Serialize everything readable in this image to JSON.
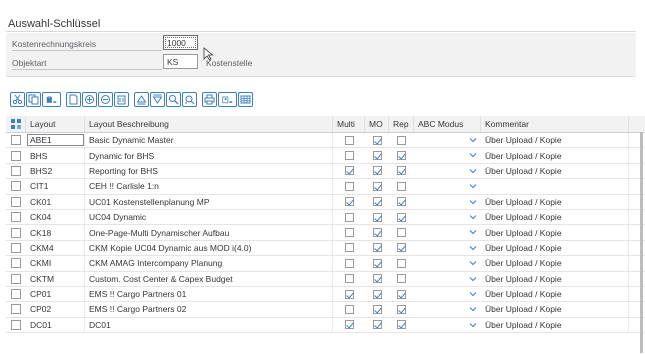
{
  "section": {
    "title": "Auswahl-Schlüssel"
  },
  "form": {
    "row1": {
      "label": "Kostenrechnungskreis",
      "value": "1000"
    },
    "row2": {
      "label": "Objektart",
      "value": "KS",
      "description": "Kostenstelle"
    }
  },
  "toolbar": {
    "icons": [
      "cut-icon",
      "copy-icon",
      "paste-icon",
      "new-row-icon",
      "append-row-icon",
      "insert-row-icon",
      "delete-row-icon",
      "copy-row-icon",
      "sort-ascending-icon",
      "sort-descending-icon",
      "find-icon",
      "find-next-icon",
      "print-icon",
      "export-icon",
      "layout-icon"
    ]
  },
  "grid": {
    "columns": {
      "layout": "Layout",
      "desc": "Layout Beschreibung",
      "multi": "Multi",
      "mo": "MO",
      "rep": "Rep",
      "abc": "ABC Modus",
      "kom": "Kommentar"
    },
    "rows": [
      {
        "layout": "ABE1",
        "desc": "Basic Dynamic Master",
        "multi": false,
        "mo": true,
        "rep": false,
        "kom": "Über Upload / Kopie"
      },
      {
        "layout": "BHS",
        "desc": "Dynamic for BHS",
        "multi": false,
        "mo": true,
        "rep": true,
        "kom": "Über Upload / Kopie"
      },
      {
        "layout": "BHS2",
        "desc": "Reporting for BHS",
        "multi": true,
        "mo": true,
        "rep": true,
        "kom": "Über Upload / Kopie"
      },
      {
        "layout": "CIT1",
        "desc": "CEH !! Carlisle 1:n",
        "multi": false,
        "mo": true,
        "rep": false,
        "kom": ""
      },
      {
        "layout": "CK01",
        "desc": "UC01 Kostenstellenplanung MP",
        "multi": true,
        "mo": true,
        "rep": true,
        "kom": "Über Upload / Kopie"
      },
      {
        "layout": "CK04",
        "desc": "UC04 Dynamic",
        "multi": false,
        "mo": true,
        "rep": true,
        "kom": "Über Upload / Kopie"
      },
      {
        "layout": "CK18",
        "desc": "One-Page-Multi Dynamischer Aufbau",
        "multi": false,
        "mo": true,
        "rep": false,
        "kom": "Über Upload / Kopie"
      },
      {
        "layout": "CKM4",
        "desc": "CKM Kopie UC04 Dynamic aus MOD i(4.0)",
        "multi": false,
        "mo": true,
        "rep": true,
        "kom": "Über Upload / Kopie"
      },
      {
        "layout": "CKMI",
        "desc": "CKM AMAG Intercompany Planung",
        "multi": false,
        "mo": true,
        "rep": false,
        "kom": "Über Upload / Kopie"
      },
      {
        "layout": "CKTM",
        "desc": "Custom. Cost Center & Capex Budget",
        "multi": false,
        "mo": true,
        "rep": false,
        "kom": "Über Upload / Kopie"
      },
      {
        "layout": "CP01",
        "desc": "EMS !! Cargo Partners 01",
        "multi": true,
        "mo": true,
        "rep": true,
        "kom": "Über Upload / Kopie"
      },
      {
        "layout": "CP02",
        "desc": "EMS !! Cargo Partners 02",
        "multi": false,
        "mo": true,
        "rep": true,
        "kom": "Über Upload / Kopie"
      },
      {
        "layout": "DC01",
        "desc": "DC01",
        "multi": true,
        "mo": true,
        "rep": true,
        "kom": "Über Upload / Kopie"
      }
    ]
  }
}
